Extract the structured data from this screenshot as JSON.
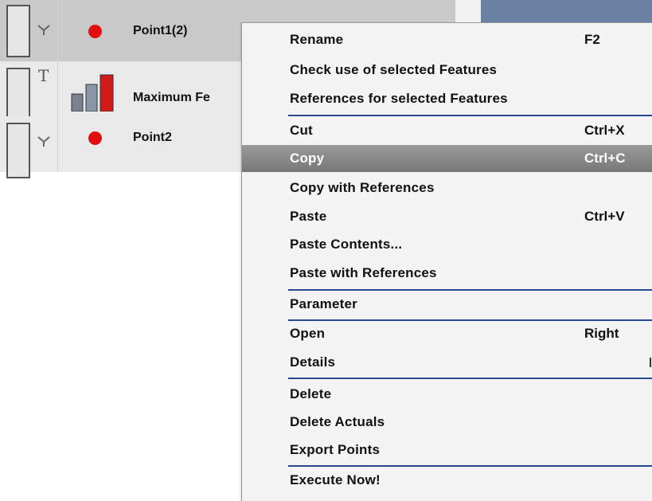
{
  "rows": [
    {
      "label": "Point1(2)",
      "icon": "red-dot-icon",
      "type_icon": "fork-icon",
      "selected": true
    },
    {
      "label": "Maximum Fe",
      "icon": "bar-chart-icon",
      "type_icon": "t-glyph-icon",
      "type_glyph": "T",
      "selected": false
    },
    {
      "label": "Point2",
      "icon": "red-dot-icon",
      "type_icon": "fork-icon",
      "selected": false
    }
  ],
  "menu": {
    "items": [
      {
        "label": "Rename",
        "shortcut": "F2"
      },
      {
        "label": "Check use of selected Features",
        "shortcut": ""
      },
      {
        "label": "References for selected Features",
        "shortcut": ""
      },
      {
        "label": "Cut",
        "shortcut": "Ctrl+X"
      },
      {
        "label": "Copy",
        "shortcut": "Ctrl+C",
        "highlighted": true
      },
      {
        "label": "Copy with References",
        "shortcut": ""
      },
      {
        "label": "Paste",
        "shortcut": "Ctrl+V"
      },
      {
        "label": "Paste Contents...",
        "shortcut": ""
      },
      {
        "label": "Paste with References",
        "shortcut": ""
      },
      {
        "label": "Parameter",
        "shortcut": ""
      },
      {
        "label": "Open",
        "shortcut": "Right"
      },
      {
        "label": "Details",
        "shortcut": ""
      },
      {
        "label": "Delete",
        "shortcut": ""
      },
      {
        "label": "Delete Actuals",
        "shortcut": ""
      },
      {
        "label": "Export Points",
        "shortcut": ""
      },
      {
        "label": "Execute Now!",
        "shortcut": ""
      }
    ]
  },
  "colors": {
    "selected_row": "#c9c9c9",
    "highlight": "#888888",
    "separator": "#2a4690",
    "point_dot": "#e01010",
    "header_band": "#6b82a4"
  }
}
